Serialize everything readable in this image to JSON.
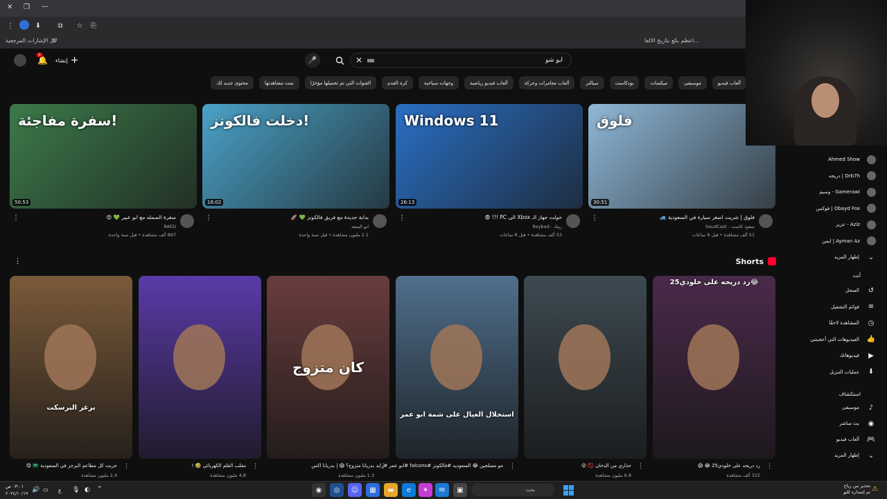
{
  "browser": {
    "bookmarks_label": "كل الإشارات المرجعية",
    "bookmark_right": "اعظم بكع بتاريخ الالعا..."
  },
  "header": {
    "create_label": "إنشاء",
    "notifications_count": "9",
    "search_value": "ابو شو"
  },
  "chips": [
    {
      "label": "",
      "active": true
    },
    {
      "label": "ألعاب فيديو"
    },
    {
      "label": "موسيقى"
    },
    {
      "label": "ميكسات"
    },
    {
      "label": "بودكاست"
    },
    {
      "label": "سيالتر"
    },
    {
      "label": "ألعاب مغامرات وحركة"
    },
    {
      "label": "ألعاب فيديو رياضية"
    },
    {
      "label": "وجهات سياحية"
    },
    {
      "label": "كرة القدم"
    },
    {
      "label": "القنوات التي تم تحميلها مؤخرًا"
    },
    {
      "label": "تمت مشاهدتها"
    },
    {
      "label": "محتوى جديد لك"
    }
  ],
  "videos": [
    {
      "thumb_text": "سفرة مفاجئة!",
      "duration": "50:53",
      "title": "سفرة الصمله مع ابو عبير 💚 😍",
      "channel": "RAED",
      "stats": "897 ألف مشاهدة • قبل سنة واحدة",
      "bg": "#3c7a4a"
    },
    {
      "thumb_text": "دخلت فالكونز!",
      "duration": "16:02",
      "title": "بداية جديدة مع فريق فالكونز 💚 🚀",
      "channel": "ابو السعد",
      "stats": "2.1 مليون مشاهدة • قبل سنة واحدة",
      "bg": "#4aa2c8"
    },
    {
      "thumb_text": "Windows 11",
      "duration": "26:13",
      "title": "حولت جهاز الـ Xbox الى PC !!! 😨",
      "channel": "ريباد - Reybad",
      "stats": "53 ألف مشاهدة • قبل 8 ساعات",
      "bg": "#2a6fc4"
    },
    {
      "thumb_text": "فلوق",
      "duration": "30:51",
      "title": "فلوق | شريت اصغر سيارة في السعودية 🚙",
      "channel": "سعود كاست - SaudCast",
      "stats": "51 ألف مشاهدة • قبل 9 ساعات",
      "bg": "#8fb8d8"
    }
  ],
  "shorts": {
    "heading": "Shorts",
    "items": [
      {
        "caption": "برغر البرسكت",
        "title": "جربت كل مطاعم البرجر في السعودية 🇸🇦 😋",
        "views": "2.4 مليون مشاهدة",
        "bg": "#7a5a3a"
      },
      {
        "caption": "",
        "title": "مقلب القلم الكهربائي 🤣 !",
        "views": "4.8 مليون مشاهدة",
        "bg": "#5b3aa8"
      },
      {
        "caption": "كان متزوج",
        "title": "بدريانا متزوج؟ 😱 | بدريانا اكس",
        "views": "1.3 مليون مشاهدة",
        "bg": "#6a3d3d"
      },
      {
        "caption": "استحلال العيال على شمة ابو عمر",
        "title": "مو مسلجين 😂 السعوديه #فالكونز #falcons #ابو عمر #رايد",
        "views": "",
        "bg": "#4f6f8c"
      },
      {
        "caption": "",
        "title": "حذاري من الدخان 🚫 😮",
        "views": "6.8 مليون مشاهدة",
        "bg": "#3d4a52"
      },
      {
        "caption": "رد دريحه على خلودي25😂",
        "title": "رد دريحه على خلودي25 😂 😱",
        "views": "315 ألف مشاهدة",
        "bg": "#4a2a4a"
      }
    ]
  },
  "sidebar": {
    "subscriptions": [
      {
        "name": "Ahmed Show"
      },
      {
        "name": "دريحه | Drb7h"
      },
      {
        "name": "وسيم - Gamerawi"
      },
      {
        "name": "فوكس | Obayd Fox"
      },
      {
        "name": "عزيز - Aziz"
      },
      {
        "name": "ايمن | Ayman Az"
      }
    ],
    "show_more": "إظهار المزيد",
    "you_label": "أنت",
    "you_items": [
      {
        "label": "السجل",
        "icon": "↺"
      },
      {
        "label": "قوائم التشغيل",
        "icon": "≡"
      },
      {
        "label": "المشاهدة لاحقًا",
        "icon": "◷"
      },
      {
        "label": "الفيديوهات التي أعجبتني",
        "icon": "👍"
      },
      {
        "label": "فيديوهاتك",
        "icon": "▶"
      },
      {
        "label": "عمليات التنزيل",
        "icon": "⬇"
      }
    ],
    "explore_label": "استكشاف",
    "explore_items": [
      {
        "label": "موسيقى",
        "icon": "♪"
      },
      {
        "label": "بث مباشر",
        "icon": "◉"
      },
      {
        "label": "ألعاب فيديو",
        "icon": "🎮"
      },
      {
        "label": "إظهار المزيد",
        "icon": "⌄"
      }
    ]
  },
  "taskbar": {
    "search_placeholder": "بحث",
    "time": "٠٣:٠١ ص",
    "date": "٢٠٢٤/١٠/١٩",
    "lang": "ع",
    "notice_line1": "تحذير من رياح",
    "notice_line2": "تم إصداره للتو"
  }
}
